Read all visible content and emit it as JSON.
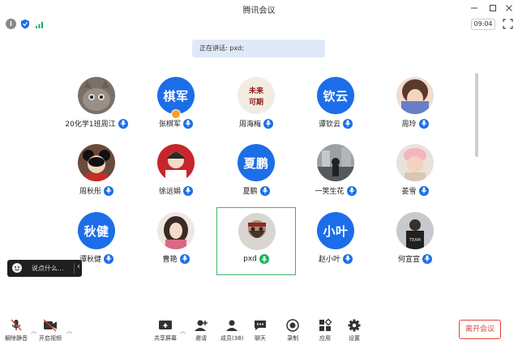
{
  "window": {
    "title": "腾讯会议"
  },
  "status": {
    "time": "09:04"
  },
  "speaking": {
    "text": "正在讲话: pxd;"
  },
  "participants": [
    {
      "name": "20化学1班周江",
      "avatar_text": "",
      "photo": "cat"
    },
    {
      "name": "张棋军",
      "avatar_text": "棋军",
      "host": true
    },
    {
      "name": "周海梅",
      "avatar_text": "",
      "photo": "calligraphy",
      "photo_text": "未来可期"
    },
    {
      "name": "谭钦云",
      "avatar_text": "钦云"
    },
    {
      "name": "周玲",
      "avatar_text": "",
      "photo": "girl"
    },
    {
      "name": "周秋彤",
      "avatar_text": "",
      "photo": "mickey"
    },
    {
      "name": "徐远娟",
      "avatar_text": "",
      "photo": "anime"
    },
    {
      "name": "夏鹏",
      "avatar_text": "夏鹏"
    },
    {
      "name": "一笑生花",
      "avatar_text": "",
      "photo": "street"
    },
    {
      "name": "姜雪",
      "avatar_text": "",
      "photo": "child"
    },
    {
      "name": "谭秋健",
      "avatar_text": "秋健"
    },
    {
      "name": "曹艳",
      "avatar_text": "",
      "photo": "woman"
    },
    {
      "name": "pxd",
      "avatar_text": "",
      "photo": "bearded",
      "active": true
    },
    {
      "name": "赵小叶",
      "avatar_text": "小叶"
    },
    {
      "name": "何宣宣",
      "avatar_text": "",
      "photo": "team"
    }
  ],
  "chat": {
    "placeholder": "说点什么..."
  },
  "toolbar": {
    "unmute": "解除静音",
    "start_video": "开启视频",
    "share_screen": "共享屏幕",
    "invite": "邀请",
    "members": "成员(38)",
    "chat": "聊天",
    "record": "录制",
    "apps": "应用",
    "settings": "设置",
    "leave": "离开会议"
  },
  "colors": {
    "accent": "#1c6ee8",
    "active_border": "#3cb371",
    "leave": "#e0453a",
    "speaking_bg": "#dfe9f7"
  }
}
